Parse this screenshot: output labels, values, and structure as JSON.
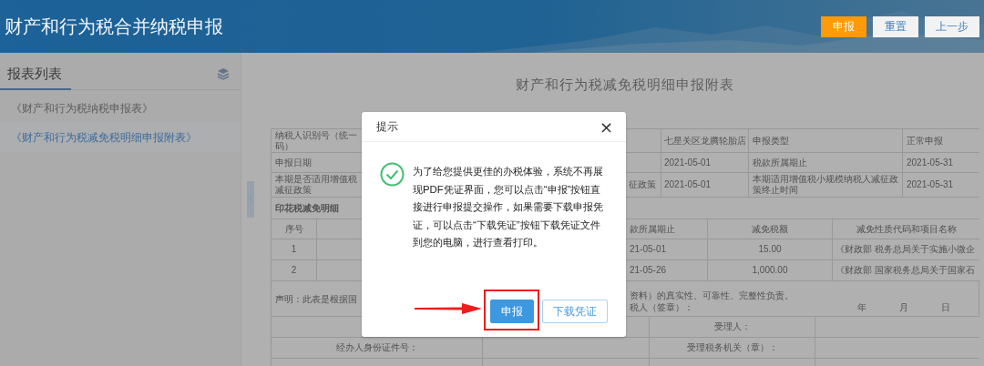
{
  "header": {
    "title": "财产和行为税合并纳税申报",
    "buttons": [
      {
        "label": "申报",
        "kind": "primary"
      },
      {
        "label": "重置",
        "kind": "default"
      },
      {
        "label": "上一步",
        "kind": "default"
      }
    ]
  },
  "sidebar": {
    "title": "报表列表",
    "items": [
      {
        "label": "《财产和行为税纳税申报表》",
        "selected": false
      },
      {
        "label": "《财产和行为税减免税明细申报附表》",
        "selected": true
      }
    ]
  },
  "form": {
    "title": "财产和行为税减免税明细申报附表",
    "info_rows": [
      {
        "column_1": [
          "纳税人识别号（统一",
          "码）"
        ],
        "column_4": [
          "七星关区龙腾轮胎店"
        ],
        "column_5": [
          "申报类型"
        ],
        "column_6": [
          "正常申报"
        ]
      },
      {
        "column_1": [
          "申报日期"
        ],
        "column_4": [
          "2021-05-01"
        ],
        "column_5": [
          "税款所属期止"
        ],
        "column_6": [
          "2021-05-31"
        ]
      },
      {
        "column_1": [
          "本期是否适用增值税",
          "减征政策"
        ],
        "column_3": [
          "征政策"
        ],
        "column_4": [
          "2021-05-01"
        ],
        "column_5": [
          "本期适用增值税小规模纳税人减征政策终止时间"
        ],
        "column_6": [
          "2021-05-31"
        ]
      }
    ],
    "section_title": "印花税减免明细",
    "detail_columns": {
      "column_1": "序号",
      "column_4": "款所属期止",
      "column_5": "减免税额",
      "column_6": "减免性质代码和项目名称"
    },
    "detail_rows": [
      {
        "column_1": "1",
        "column_4": "21-05-01",
        "column_5": "15.00",
        "column_6": "《财政部 税务总局关于实施小微企"
      },
      {
        "column_1": "2",
        "column_4": "21-05-26",
        "column_5": "1,000.00",
        "column_6": "《财政部 国家税务总局关于国家石"
      }
    ],
    "declaration": {
      "left": "声明：此表是根据国",
      "right_lines": [
        "资料）的真实性、可靠性、完整性负责。",
        "税人（签章）："
      ],
      "date": [
        "年",
        "月",
        "日"
      ]
    },
    "sign_rows": [
      {
        "column_3": "受理人："
      },
      {
        "column_1": "经办人身份证件号：",
        "column_3": "受理税务机关（章）："
      }
    ]
  },
  "dialog": {
    "title": "提示",
    "close": "×",
    "message": "为了给您提供更佳的办税体验，系统不再展现PDF凭证界面，您可以点击“申报”按钮直接进行申报提交操作，如果需要下载申报凭证，可以点击“下载凭证”按钮下载凭证文件到您的电脑，进行查看打印。",
    "buttons": [
      {
        "label": "申报",
        "kind": "primary",
        "highlighted": true
      },
      {
        "label": "下载凭证",
        "kind": "default",
        "highlighted": false
      }
    ]
  }
}
